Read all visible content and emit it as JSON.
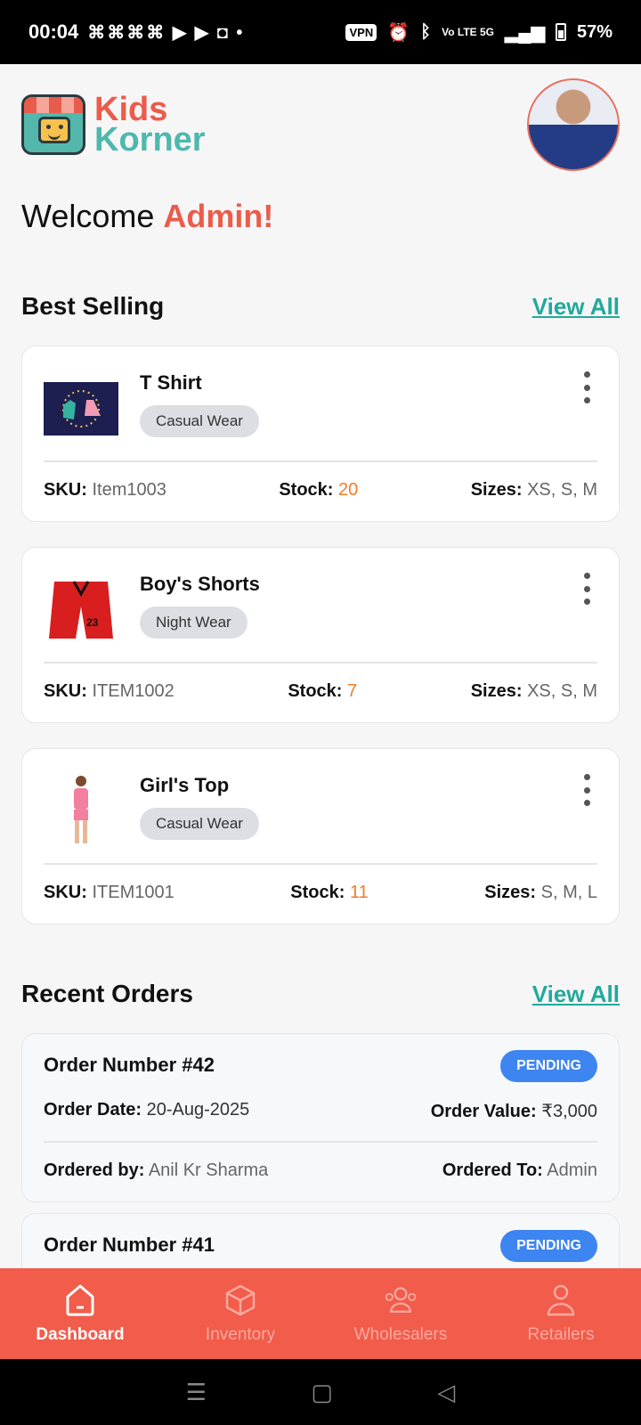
{
  "status_bar": {
    "time": "00:04",
    "notifications": "⌘⌘⌘⌘ ▶ ▶ ◘ •",
    "vpn": "VPN",
    "network": "Vo LTE 5G",
    "battery": "57%"
  },
  "brand": {
    "line1": "Kids",
    "line2": "Korner"
  },
  "welcome": {
    "prefix": "Welcome ",
    "name": "Admin!"
  },
  "best_selling": {
    "title": "Best Selling",
    "view_all": "View All",
    "items": [
      {
        "name": "T Shirt",
        "tag": "Casual Wear",
        "sku_label": "SKU:",
        "sku": "Item1003",
        "stock_label": "Stock:",
        "stock": "20",
        "sizes_label": "Sizes:",
        "sizes": "XS, S, M"
      },
      {
        "name": "Boy's Shorts",
        "tag": "Night Wear",
        "sku_label": "SKU:",
        "sku": "ITEM1002",
        "stock_label": "Stock:",
        "stock": "7",
        "sizes_label": "Sizes:",
        "sizes": "XS, S, M"
      },
      {
        "name": "Girl's Top",
        "tag": "Casual Wear",
        "sku_label": "SKU:",
        "sku": "ITEM1001",
        "stock_label": "Stock:",
        "stock": "11",
        "sizes_label": "Sizes:",
        "sizes": "S, M, L"
      }
    ]
  },
  "recent_orders": {
    "title": "Recent Orders",
    "view_all": "View All",
    "orders": [
      {
        "number": "Order Number #42",
        "status": "PENDING",
        "date_label": "Order Date:",
        "date": "20-Aug-2025",
        "value_label": "Order Value:",
        "value": "₹3,000",
        "by_label": "Ordered by:",
        "by": "Anil Kr Sharma",
        "to_label": "Ordered To:",
        "to": "Admin"
      },
      {
        "number": "Order Number #41",
        "status": "PENDING"
      }
    ]
  },
  "bottom_nav": [
    {
      "label": "Dashboard",
      "icon": "home-icon",
      "active": true
    },
    {
      "label": "Inventory",
      "icon": "box-icon",
      "active": false
    },
    {
      "label": "Wholesalers",
      "icon": "users-icon",
      "active": false
    },
    {
      "label": "Retailers",
      "icon": "user-icon",
      "active": false
    }
  ],
  "colors": {
    "brand_red": "#ec5c4b",
    "brand_teal": "#4fb8ad",
    "link_teal": "#22a99c",
    "stock_orange": "#ef7c2c",
    "badge_blue": "#3d85f0",
    "nav_bg": "#f15c4b"
  }
}
